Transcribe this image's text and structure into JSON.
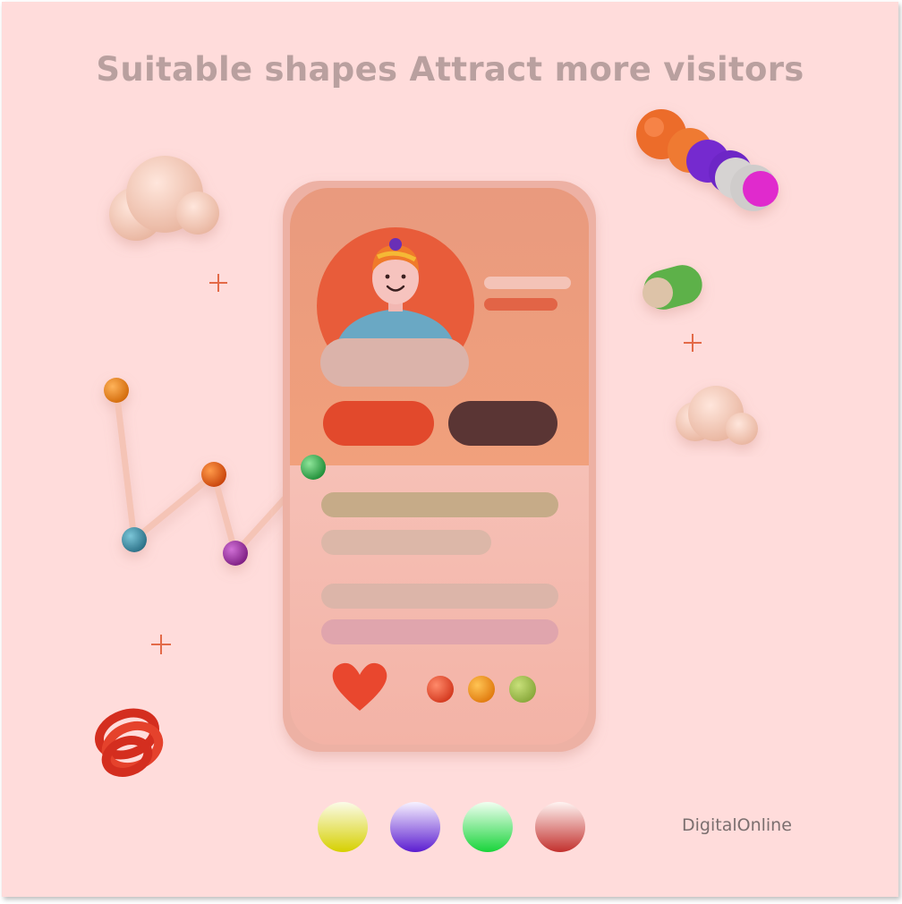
{
  "header": {
    "title": "Suitable shapes Attract more visitors"
  },
  "footer": {
    "brand": "DigitalOnline",
    "swatches": [
      {
        "name": "yellow",
        "top": "#fbfbe9",
        "bottom": "#d6d000"
      },
      {
        "name": "purple",
        "top": "#f7f2ff",
        "bottom": "#5b1dd0"
      },
      {
        "name": "green",
        "top": "#f1fff1",
        "bottom": "#18d43a"
      },
      {
        "name": "red",
        "top": "#fff4f2",
        "bottom": "#c2302d"
      }
    ]
  },
  "colors": {
    "background": "#ffdcdb",
    "phone_top": "#ee9c7c",
    "phone_bottom": "#f5b7ad",
    "avatar_circle": "#e85c3a",
    "button_primary": "#e2492c",
    "button_secondary": "#5a3534",
    "heart": "#e9472e",
    "toggle_on": "#5db14a"
  },
  "decorations": {
    "icons": [
      "cloud-icon",
      "plus-icon",
      "bead-chain-icon",
      "toggle-icon",
      "line-chart-icon",
      "spring-coil-icon",
      "heart-icon"
    ],
    "mini_chart_dots": [
      "#e8880e",
      "#3f8fa8",
      "#e1570f",
      "#a43aa6",
      "#37b24e"
    ]
  }
}
